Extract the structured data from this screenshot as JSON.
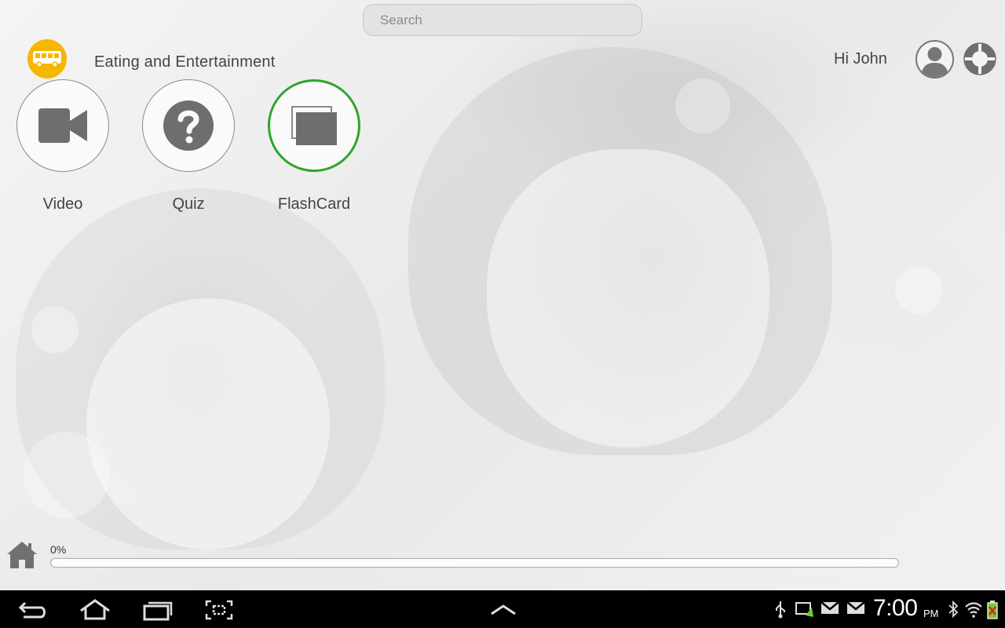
{
  "search": {
    "placeholder": "Search"
  },
  "header": {
    "category_icon": "bus-icon",
    "category_icon_color": "#F5B700",
    "category_title": "Eating and Entertainment",
    "greeting": "Hi John",
    "profile_icon": "user-avatar-icon",
    "help_icon": "lifebuoy-icon"
  },
  "activities": [
    {
      "label": "Video",
      "icon": "video-camera-icon",
      "selected": false
    },
    {
      "label": "Quiz",
      "icon": "question-mark-icon",
      "selected": false
    },
    {
      "label": "FlashCard",
      "icon": "flashcards-icon",
      "selected": true
    }
  ],
  "colors": {
    "selected_ring": "#2EA52E",
    "icon_gray": "#6E6E6E"
  },
  "progress": {
    "label": "0%",
    "value": 0
  },
  "system_bar": {
    "nav": [
      "back-icon",
      "home-icon",
      "recent-apps-icon",
      "screenshot-icon"
    ],
    "center": "chevron-up-icon",
    "status_icons": [
      "usb-icon",
      "sync-icon",
      "gmail-icon",
      "gmail-icon",
      "bluetooth-icon",
      "wifi-icon",
      "battery-icon"
    ],
    "time": "7:00",
    "ampm": "PM"
  }
}
